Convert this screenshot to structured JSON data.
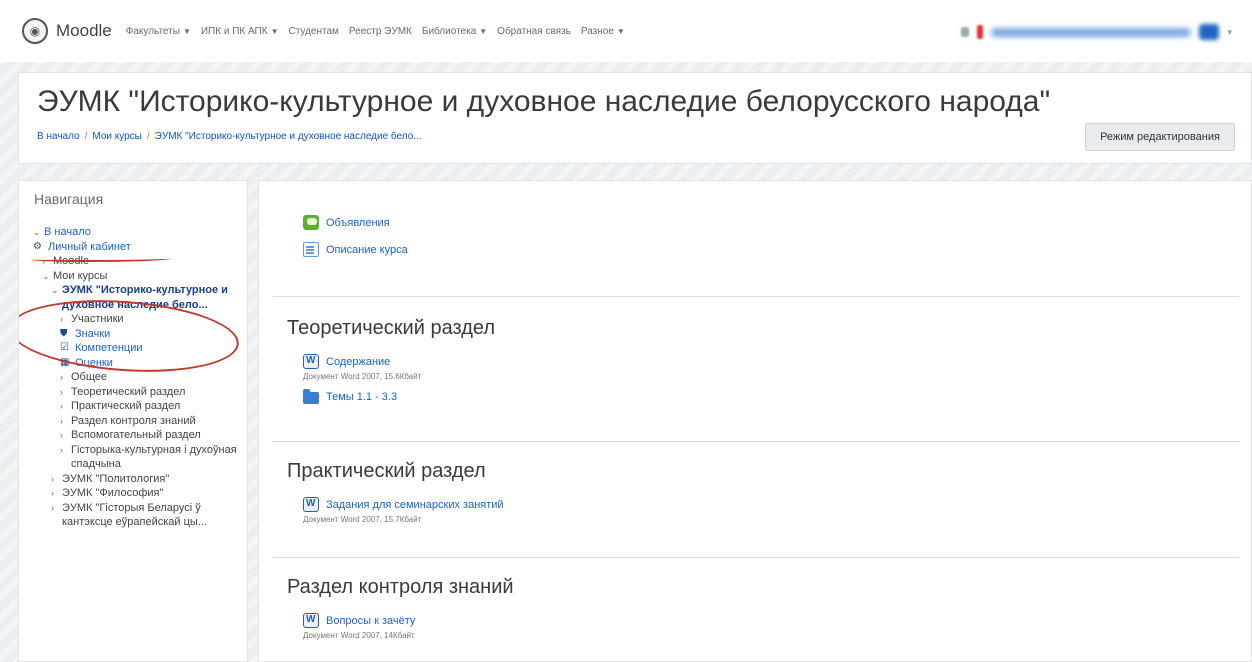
{
  "navbar": {
    "brand": "Moodle",
    "menu": [
      {
        "label": "Факультеты",
        "has_caret": true
      },
      {
        "label": "ИПК и ПК АПК",
        "has_caret": true
      },
      {
        "label": "Студентам",
        "has_caret": false
      },
      {
        "label": "Реестр ЭУМК",
        "has_caret": false
      },
      {
        "label": "Библиотека",
        "has_caret": true
      },
      {
        "label": "Обратная связь",
        "has_caret": false
      },
      {
        "label": "Разное",
        "has_caret": true
      }
    ]
  },
  "header": {
    "title": "ЭУМК \"Историко-культурное и духовное наследие белорусского народа\"",
    "breadcrumb": [
      "В начало",
      "Мои курсы",
      "ЭУМК \"Историко-культурное и духовное наследие бело..."
    ],
    "edit_button": "Режим редактирования"
  },
  "navigation": {
    "heading": "Навигация",
    "items": [
      {
        "label": "В начало",
        "chev": "⌄",
        "indent": 0,
        "link": true
      },
      {
        "label": "Личный кабинет",
        "icon": "dashboard-icon",
        "indent": 0,
        "link": true
      },
      {
        "label": "Moodle",
        "chev": "›",
        "indent": 1
      },
      {
        "label": "Мои курсы",
        "chev": "⌄",
        "indent": 1
      },
      {
        "label": "ЭУМК \"Историко-культурное и духовное наследие бело...",
        "chev": "⌄",
        "indent": 2,
        "bold": true
      },
      {
        "label": "Участники",
        "chev": "›",
        "indent": 3
      },
      {
        "label": "Значки",
        "icon": "badge-icon",
        "indent": 3
      },
      {
        "label": "Компетенции",
        "icon": "checkbox-icon",
        "indent": 3
      },
      {
        "label": "Оценки",
        "icon": "table-icon",
        "indent": 3
      },
      {
        "label": "Общее",
        "chev": "›",
        "indent": 3
      },
      {
        "label": "Теоретический раздел",
        "chev": "›",
        "indent": 3
      },
      {
        "label": "Практический раздел",
        "chev": "›",
        "indent": 3
      },
      {
        "label": "Раздел контроля знаний",
        "chev": "›",
        "indent": 3
      },
      {
        "label": "Вспомогательный раздел",
        "chev": "›",
        "indent": 3
      },
      {
        "label": "Гісторыка-культурная і духоўная спадчына",
        "chev": "›",
        "indent": 3,
        "wrap": true
      },
      {
        "label": "ЭУМК \"Политология\"",
        "chev": "›",
        "indent": 2
      },
      {
        "label": "ЭУМК \"Философия\"",
        "chev": "›",
        "indent": 2
      },
      {
        "label": "ЭУМК \"Гісторыя Беларусі ў кантэксце еўрапейскай цы...",
        "chev": "›",
        "indent": 2,
        "wrap": true
      }
    ]
  },
  "main": {
    "general": [
      {
        "label": "Объявления",
        "icon": "forum-icon"
      },
      {
        "label": "Описание курса",
        "icon": "page-icon"
      }
    ],
    "sections": [
      {
        "title": "Теоретический раздел",
        "activities": [
          {
            "label": "Содержание",
            "icon": "word-icon",
            "meta": "Документ Word 2007, 15.6Кбайт"
          },
          {
            "label": "Темы 1.1 - 3.3",
            "icon": "folder-icon"
          }
        ]
      },
      {
        "title": "Практический раздел",
        "activities": [
          {
            "label": "Задания для семинарских занятий",
            "icon": "word-icon",
            "meta": "Документ Word 2007, 15.7Кбайт"
          }
        ]
      },
      {
        "title": "Раздел контроля знаний",
        "activities": [
          {
            "label": "Вопросы к зачёту",
            "icon": "word-icon",
            "meta": "Документ Word 2007, 14Кбайт"
          }
        ]
      }
    ]
  }
}
